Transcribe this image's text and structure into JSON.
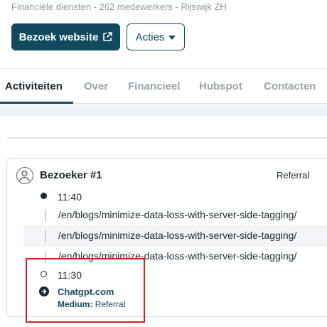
{
  "company": {
    "subtitle": "Financiële diensten - 262 medewerkers - Rijswijk ZH"
  },
  "actions": {
    "visit_label": "Bezoek website",
    "actions_label": "Acties"
  },
  "tabs": [
    {
      "label": "Activiteiten",
      "active": true
    },
    {
      "label": "Over",
      "active": false
    },
    {
      "label": "Financieel",
      "active": false
    },
    {
      "label": "Hubspot",
      "active": false
    },
    {
      "label": "Contacten",
      "active": false
    }
  ],
  "visitor": {
    "label": "Bezoeker #1",
    "source": "Referral",
    "sessions": [
      {
        "time": "11:40",
        "pages": [
          "/en/blogs/minimize-data-loss-with-server-side-tagging/",
          "/en/blogs/minimize-data-loss-with-server-side-tagging/",
          "/en/blogs/minimize-data-loss-with-server-side-tagging/"
        ]
      },
      {
        "time": "11:30",
        "referrer": {
          "site": "Chatgpt.com",
          "medium_label": "Medium:",
          "medium_value": "Referral"
        }
      }
    ]
  },
  "colors": {
    "brand": "#114a5e",
    "highlight": "#e0191f",
    "muted": "#9aa4ad"
  },
  "icons": [
    "external-link-icon",
    "caret-down-icon",
    "user-icon",
    "arrow-right-circle-icon"
  ]
}
